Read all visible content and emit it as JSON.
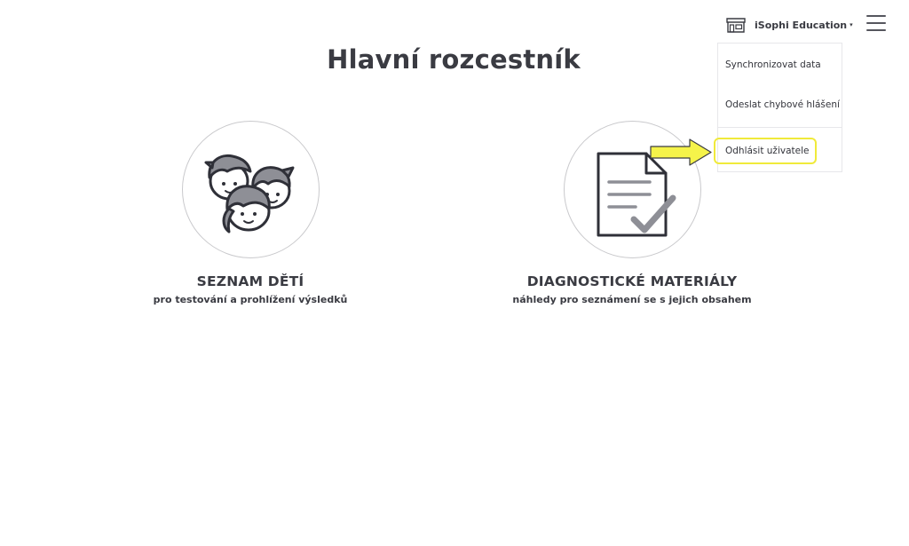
{
  "header": {
    "organization_name": "iSophi Education",
    "caret": "▾",
    "icons": {
      "organization": "store-icon",
      "menu": "hamburger-menu-icon"
    }
  },
  "page": {
    "title": "Hlavní rozcestník"
  },
  "dropdown": {
    "items": [
      {
        "label": "Synchronizovat data"
      },
      {
        "label": "Odeslat chybové hlášení"
      },
      {
        "label": "Odhlásit uživatele"
      }
    ],
    "highlighted_item": "Odhlásit uživatele",
    "highlight_color": "#f0ea3a"
  },
  "cards": [
    {
      "title": "SEZNAM DĚTÍ",
      "subtitle": "pro testování a prohlížení výsledků",
      "icon": "children-faces-icon"
    },
    {
      "title": "DIAGNOSTICKÉ MATERIÁLY",
      "subtitle": "náhledy pro seznámení se s jejich obsahem",
      "icon": "documents-check-icon"
    }
  ],
  "colors": {
    "text": "#3a3b42",
    "icon_fill": "#8e8f96",
    "icon_stroke": "#2f3038",
    "arrow_fill": "#f5f34a",
    "background": "#ffffff"
  }
}
